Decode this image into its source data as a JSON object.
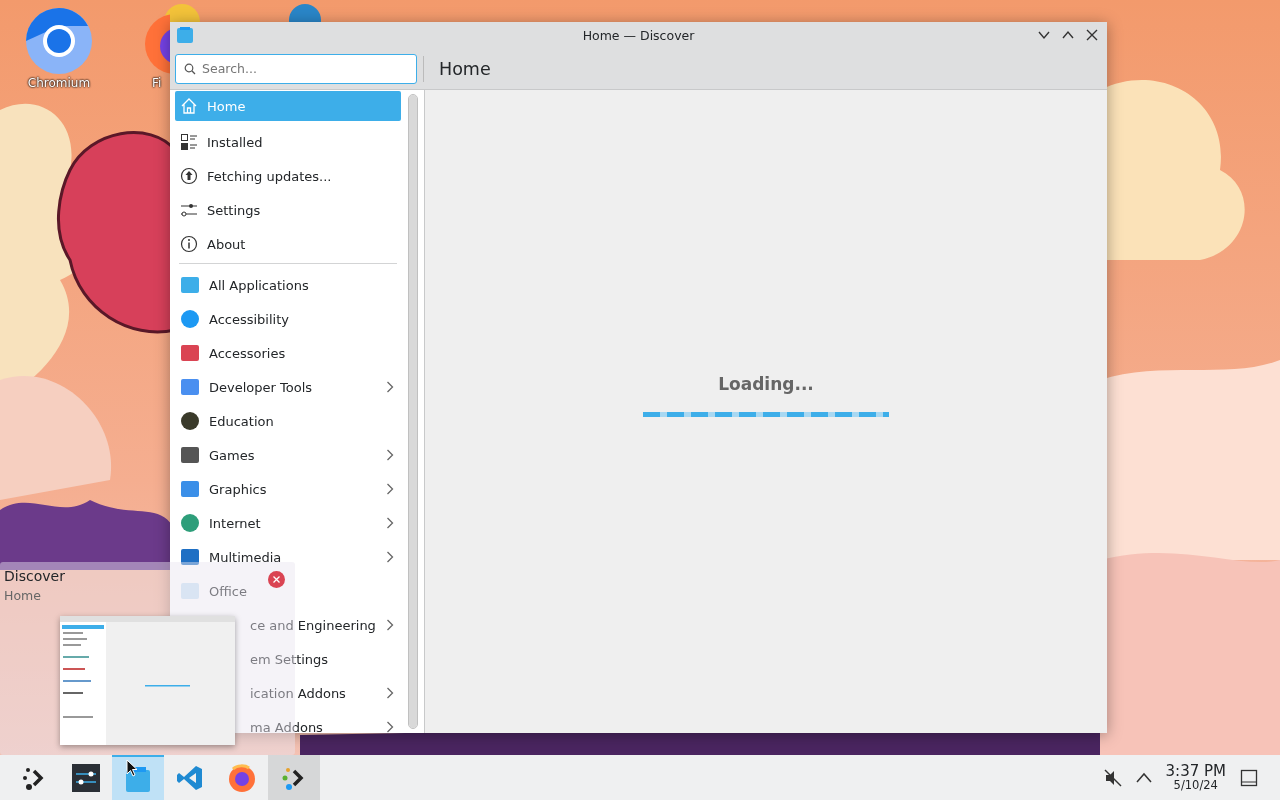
{
  "desktop_icons": [
    {
      "label": "Chromium"
    },
    {
      "label": "Fi"
    }
  ],
  "window": {
    "title": "Home — Discover"
  },
  "search": {
    "placeholder": "Search..."
  },
  "sidebar": {
    "items": [
      {
        "label": "Home",
        "kind": "nav",
        "selected": true,
        "has_children": false,
        "covered": false
      },
      {
        "label": "Installed",
        "kind": "nav",
        "selected": false,
        "has_children": false,
        "covered": false
      },
      {
        "label": "Fetching updates...",
        "kind": "nav",
        "selected": false,
        "has_children": false,
        "covered": false
      },
      {
        "label": "Settings",
        "kind": "nav",
        "selected": false,
        "has_children": false,
        "covered": false
      },
      {
        "label": "About",
        "kind": "nav",
        "selected": false,
        "has_children": false,
        "covered": false
      },
      {
        "label": "All Applications",
        "kind": "category",
        "selected": false,
        "has_children": false,
        "covered": false
      },
      {
        "label": "Accessibility",
        "kind": "category",
        "selected": false,
        "has_children": false,
        "covered": false
      },
      {
        "label": "Accessories",
        "kind": "category",
        "selected": false,
        "has_children": false,
        "covered": false
      },
      {
        "label": "Developer Tools",
        "kind": "category",
        "selected": false,
        "has_children": true,
        "covered": false
      },
      {
        "label": "Education",
        "kind": "category",
        "selected": false,
        "has_children": false,
        "covered": false
      },
      {
        "label": "Games",
        "kind": "category",
        "selected": false,
        "has_children": true,
        "covered": false
      },
      {
        "label": "Graphics",
        "kind": "category",
        "selected": false,
        "has_children": true,
        "covered": false
      },
      {
        "label": "Internet",
        "kind": "category",
        "selected": false,
        "has_children": true,
        "covered": false
      },
      {
        "label": "Multimedia",
        "kind": "category",
        "selected": false,
        "has_children": true,
        "covered": false
      },
      {
        "label": "Office",
        "kind": "category",
        "selected": false,
        "has_children": false,
        "covered": false
      },
      {
        "label": "ce and Engineering",
        "kind": "category",
        "selected": false,
        "has_children": true,
        "covered": true
      },
      {
        "label": "em Settings",
        "kind": "category",
        "selected": false,
        "has_children": false,
        "covered": true
      },
      {
        "label": "ication Addons",
        "kind": "category",
        "selected": false,
        "has_children": true,
        "covered": true
      },
      {
        "label": "ma Addons",
        "kind": "category",
        "selected": false,
        "has_children": true,
        "covered": true
      }
    ]
  },
  "page": {
    "title": "Home",
    "status": "Loading..."
  },
  "tooltip": {
    "title": "Discover",
    "subtitle": "Home"
  },
  "taskbar": {
    "items": [
      {
        "kind": "launcher",
        "selected": false,
        "running": false
      },
      {
        "kind": "settings",
        "selected": false,
        "running": false
      },
      {
        "kind": "discover",
        "selected": true,
        "running": true
      },
      {
        "kind": "code",
        "selected": false,
        "running": false
      },
      {
        "kind": "firefox",
        "selected": false,
        "running": false
      },
      {
        "kind": "connect",
        "selected": false,
        "running": true
      }
    ]
  },
  "tray": {
    "muted": true,
    "time": "3:37 PM",
    "date": "5/10/24"
  }
}
